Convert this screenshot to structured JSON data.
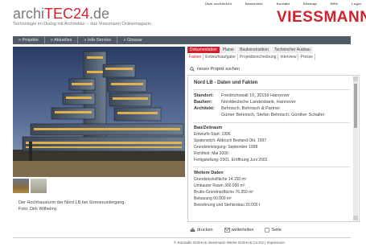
{
  "top_links": [
    "Über architec24",
    "Newsletter",
    "Kontakt",
    "Sitemap",
    "Hilfe",
    "Login"
  ],
  "brand": {
    "prefix": "archi",
    "accent": "TEC24",
    "suffix": ".de",
    "tagline": "Technologie im Dialog mit Architektur – das Viessmann Onlinemagazin",
    "company_logo": "VIESSMANN"
  },
  "navbar": [
    "Projekte",
    "Aktuelles",
    "Info-Service",
    "Glossar"
  ],
  "photo_caption": "Der Hochhausturm der Nord LB bei Sonnenuntergang.",
  "photo_credit": "Foto: Dirk Wilhelmy",
  "tabs_top": [
    "Dokumentation",
    "Planer",
    "Baukonstruktion",
    "Technischer Ausbau"
  ],
  "tabs_bottom": [
    "Fakten",
    "Entwurfsaufgabe",
    "Projektbeschreibung",
    "Interview",
    "Presse"
  ],
  "search_label": "neues Projekt suchen",
  "panel": {
    "heading": "Nord LB - Daten und Fakten",
    "facts": [
      {
        "k": "Standort:",
        "v": "Friedrichswall 10, 30159 Hannover"
      },
      {
        "k": "Bauherr:",
        "v": "Norddeutsche Landesbank, Hannover"
      },
      {
        "k": "Architekt:",
        "v": "Behnisch, Behnisch & Partner"
      },
      {
        "k": "",
        "v": "Günter Behnisch, Stefan Behnisch, Günther Schaller"
      }
    ],
    "zeitraum_title": "Bau/Zeitraum",
    "zeitraum": [
      "Entwurfs-Start: 1996",
      "Spatenstich: Abbruch Bestand Okt. 1997",
      "Grundsteinlegung: September 1998",
      "Richtfest: Mai 2000",
      "Fertigstellung: 2001, Eröffnung Juni 2002"
    ],
    "weitere_title": "Weitere Daten",
    "weitere": [
      "Grundstücksfläche 14.150 m²",
      "Umbauter Raum 300.000 m³",
      "Brutto-Grundrissfläche 76.350 m²",
      "Bebauung 60.000 m²",
      "Bewohnung und Stehlenbau 20.000 t"
    ]
  },
  "actions": [
    "drucken",
    "weiterleiten",
    "Seite"
  ],
  "footer": "© Konradin GmbH & Viessmann Werke GmbH & Co KG | Impressum",
  "colors": {
    "accent_red": "#d1222c",
    "nav_bg": "#4f5c68"
  }
}
